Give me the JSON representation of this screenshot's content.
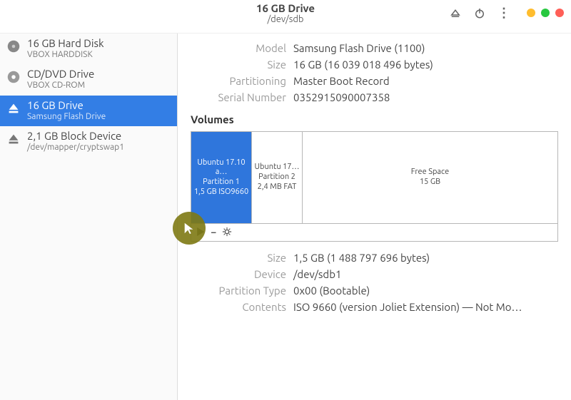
{
  "header": {
    "title": "16 GB Drive",
    "subtitle": "/dev/sdb"
  },
  "sidebar": {
    "items": [
      {
        "title": "16 GB Hard Disk",
        "sub": "VBOX HARDDISK",
        "icon": "disk"
      },
      {
        "title": "CD/DVD Drive",
        "sub": "VBOX CD-ROM",
        "icon": "optical"
      },
      {
        "title": "16 GB Drive",
        "sub": "Samsung Flash Drive",
        "icon": "eject"
      },
      {
        "title": "2,1 GB Block Device",
        "sub": "/dev/mapper/cryptswap1",
        "icon": "eject"
      }
    ],
    "selected_index": 2
  },
  "drive": {
    "model_label": "Model",
    "model_value": "Samsung Flash Drive (1100)",
    "size_label": "Size",
    "size_value": "16 GB (16 039 018 496 bytes)",
    "part_label": "Partitioning",
    "part_value": "Master Boot Record",
    "serial_label": "Serial Number",
    "serial_value": "0352915090007358"
  },
  "volumes_title": "Volumes",
  "volumes": [
    {
      "label": "Ubuntu 17.10 a…",
      "meta1": "Partition 1",
      "meta2": "1,5 GB ISO9660",
      "selected": true,
      "width": 80
    },
    {
      "label": "Ubuntu 17…",
      "meta1": "Partition 2",
      "meta2": "2,4 MB FAT",
      "selected": false,
      "width": 66
    },
    {
      "label": "Free Space",
      "meta1": "15 GB",
      "meta2": "",
      "selected": false,
      "width": 0
    }
  ],
  "partition": {
    "size_label": "Size",
    "size_value": "1,5 GB (1 488 797 696 bytes)",
    "device_label": "Device",
    "device_value": "/dev/sdb1",
    "type_label": "Partition Type",
    "type_value": "0x00 (Bootable)",
    "contents_label": "Contents",
    "contents_value": "ISO 9660 (version Joliet Extension) — Not Mo…"
  }
}
